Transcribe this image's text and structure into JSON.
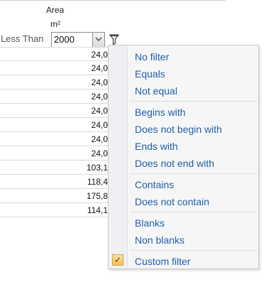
{
  "column": {
    "title_line1": "Area",
    "title_line2": "m²"
  },
  "filter_row": {
    "operator_label": "Less Than",
    "value": "2000",
    "icons": {
      "dropdown": "chevron-down-icon",
      "filter": "funnel-icon"
    }
  },
  "rows": [
    "24,0",
    "24,0",
    "24,0",
    "24,0",
    "24,0",
    "24,0",
    "24,0",
    "24,0",
    "103,1",
    "118,4",
    "175,8",
    "114,1"
  ],
  "menu": {
    "items": [
      {
        "label": "No filter"
      },
      {
        "label": "Equals"
      },
      {
        "label": "Not equal"
      },
      {
        "label": "Begins with"
      },
      {
        "label": "Does not begin with"
      },
      {
        "label": "Ends with"
      },
      {
        "label": "Does not end with"
      },
      {
        "label": "Contains"
      },
      {
        "label": "Does not contain"
      },
      {
        "label": "Blanks"
      },
      {
        "label": "Non blanks"
      },
      {
        "label": "Custom filter",
        "checked": true
      }
    ],
    "check_glyph": "✓"
  },
  "colors": {
    "menu_text": "#1f5fa8",
    "menu_bg": "#f6f6f6",
    "check_bg": "#f2c25a"
  }
}
